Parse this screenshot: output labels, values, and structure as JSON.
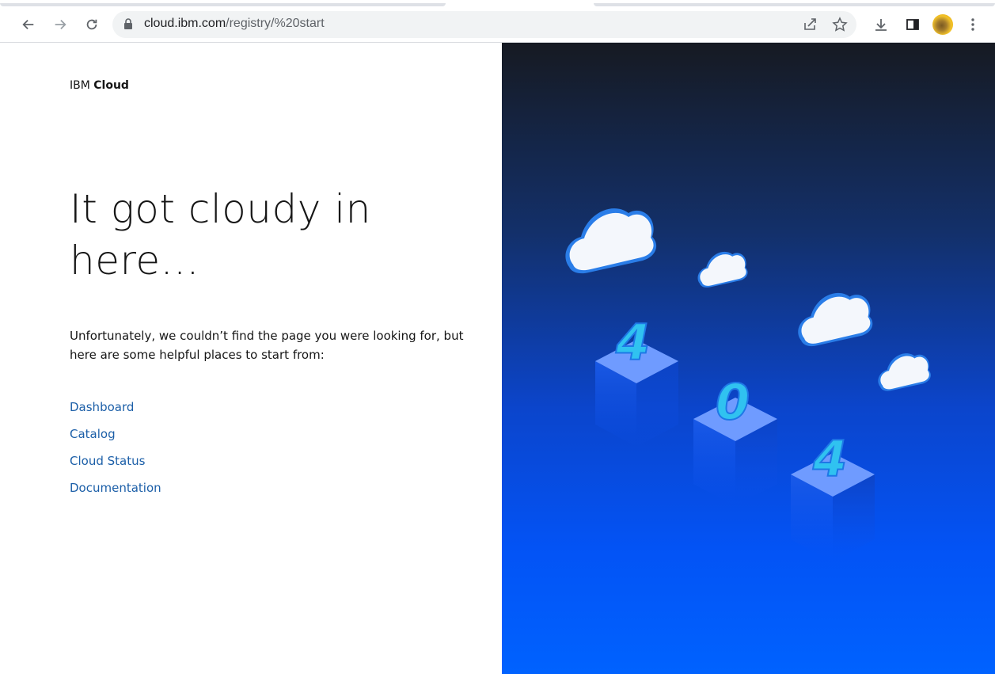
{
  "browser": {
    "url_host": "cloud.ibm.com",
    "url_path": "/registry/%20start",
    "icons": [
      "back-icon",
      "forward-icon",
      "reload-icon",
      "lock-icon",
      "share-icon",
      "star-icon",
      "download-icon",
      "side-panel-icon",
      "avatar",
      "more-icon"
    ]
  },
  "page": {
    "brand_prefix": "IBM ",
    "brand_bold": "Cloud",
    "headline_line1": "It got cloudy in",
    "headline_line2": "here...",
    "description": "Unfortunately, we couldn’t find the page you were looking for, but here are some helpful places to start from:",
    "links": [
      "Dashboard",
      "Catalog",
      "Cloud Status",
      "Documentation"
    ]
  },
  "illustration": {
    "digits": [
      "4",
      "0",
      "4"
    ]
  },
  "colors": {
    "link": "#1c5fa8",
    "panel_top": "#161a22",
    "panel_bottom": "#0062ff",
    "accent_cyan": "#30c2f0"
  }
}
